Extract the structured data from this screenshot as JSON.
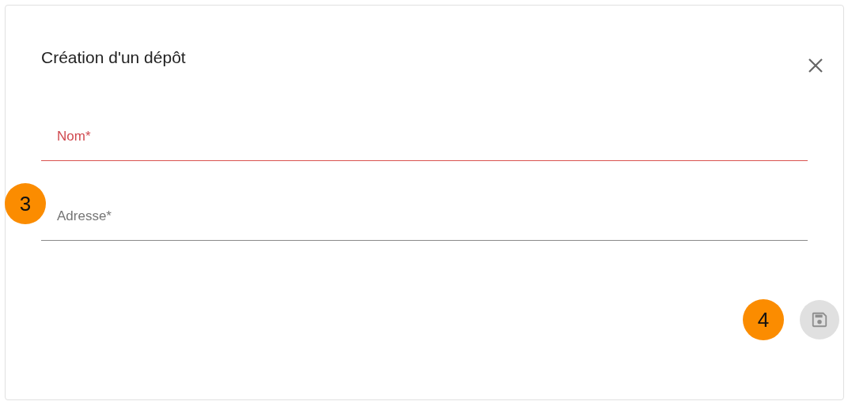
{
  "dialog": {
    "title": "Création d'un dépôt"
  },
  "fields": [
    {
      "placeholder": "Nom*",
      "error": true
    },
    {
      "placeholder": "Adresse*",
      "error": false
    }
  ],
  "save_button": {
    "disabled": true
  },
  "callouts": [
    {
      "text": "3",
      "kind": "fields"
    },
    {
      "text": "4",
      "kind": "actions"
    }
  ]
}
